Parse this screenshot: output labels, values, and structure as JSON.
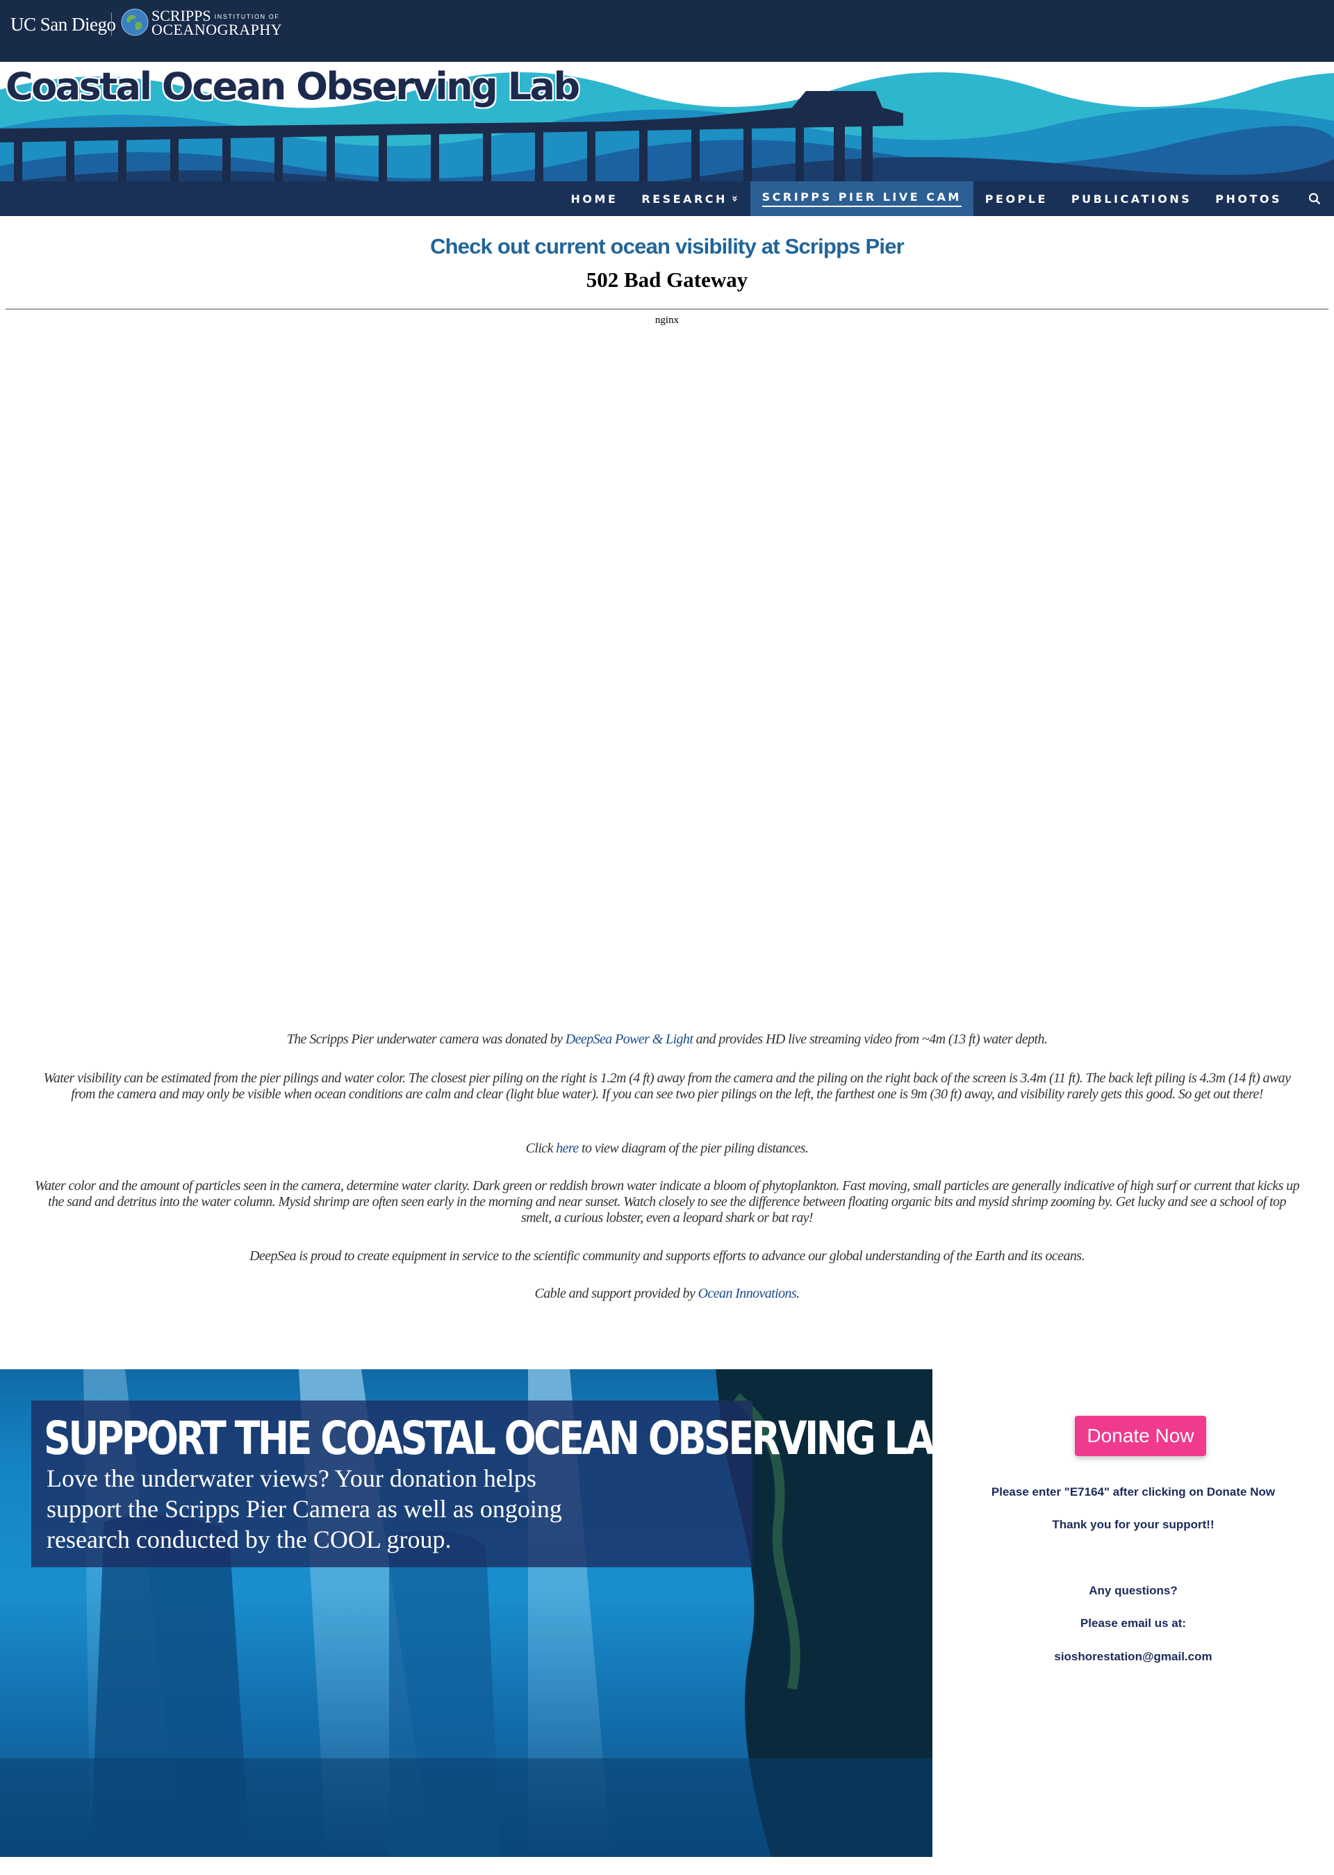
{
  "header": {
    "ucsd_logo": "UC San Diego",
    "sio_logo_line1": "SCRIPPS",
    "sio_logo_small": "INSTITUTION OF",
    "sio_logo_line2": "OCEANOGRAPHY",
    "site_title": "Coastal Ocean Observing Lab"
  },
  "nav": {
    "items": [
      {
        "label": "HOME"
      },
      {
        "label": "RESEARCH"
      },
      {
        "label": "SCRIPPS PIER LIVE CAM"
      },
      {
        "label": "PEOPLE"
      },
      {
        "label": "PUBLICATIONS"
      },
      {
        "label": "PHOTOS"
      }
    ],
    "research_chevron": "»",
    "search_icon": "search-icon",
    "active": "SCRIPPS PIER LIVE CAM"
  },
  "main": {
    "heading": "Check out current ocean visibility at Scripps Pier",
    "embed_error": {
      "title": "502 Bad Gateway",
      "server": "nginx"
    },
    "p1": {
      "a": "The Scripps Pier underwater camera was donated by ",
      "link": "DeepSea Power & Light",
      "b": " and provides HD live streaming video from ~4m (13 ft) water depth."
    },
    "p2": "Water visibility can be estimated  from the pier pilings and water color. The closest  pier piling on the right is  1.2m (4 ft)  away from the camera and the piling on the right back of the screen is 3.4m (11 ft). The back left piling is 4.3m (14 ft) away from the camera and  may only be visible when ocean conditions are calm and clear (light blue water).  If you can  see two pier pilings on the left, the farthest one  is 9m (30 ft) away, and visibility rarely gets this good. So get out there!",
    "p3": {
      "a": "Click ",
      "link": "here",
      "b": " to view diagram of the pier piling distances."
    },
    "p4": "Water color and the amount of particles seen in the camera, determine water clarity. Dark green or reddish  brown water indicate a bloom of phytoplankton. Fast moving, small particles are generally indicative of high surf or current that kicks up the sand  and detritus into the water column. Mysid shrimp are often seen early in the morning and near sunset. Watch closely to see the difference between floating organic bits and mysid shrimp zooming by. Get lucky and see a school of top smelt, a curious lobster, even a leopard shark or bat ray!",
    "p5": "DeepSea is proud to create equipment in service to the scientific community and supports efforts to advance our global understanding of the Earth and its oceans.",
    "p6": {
      "a": "Cable and support provided by ",
      "link": "Ocean Innovations",
      "b": "."
    }
  },
  "support": {
    "title": "SUPPORT THE COASTAL OCEAN OBSERVING LAB",
    "text": "Love the underwater views? Your donation helps support the Scripps Pier Camera as well as ongoing research conducted by the COOL group.",
    "donate_label": "Donate Now",
    "note1": "Please enter \"E7164\"  after clicking on Donate Now",
    "note2": "Thank you for your support!!",
    "note3": "Any questions?",
    "note4": "Please email us at:",
    "email": "sioshorestation@gmail.com"
  },
  "colors": {
    "navy": "#182b49",
    "nav_active": "#2c5f93",
    "heading_blue": "#21659b",
    "link_blue": "#1a4b87",
    "donate_pink": "#ef3a8d"
  }
}
